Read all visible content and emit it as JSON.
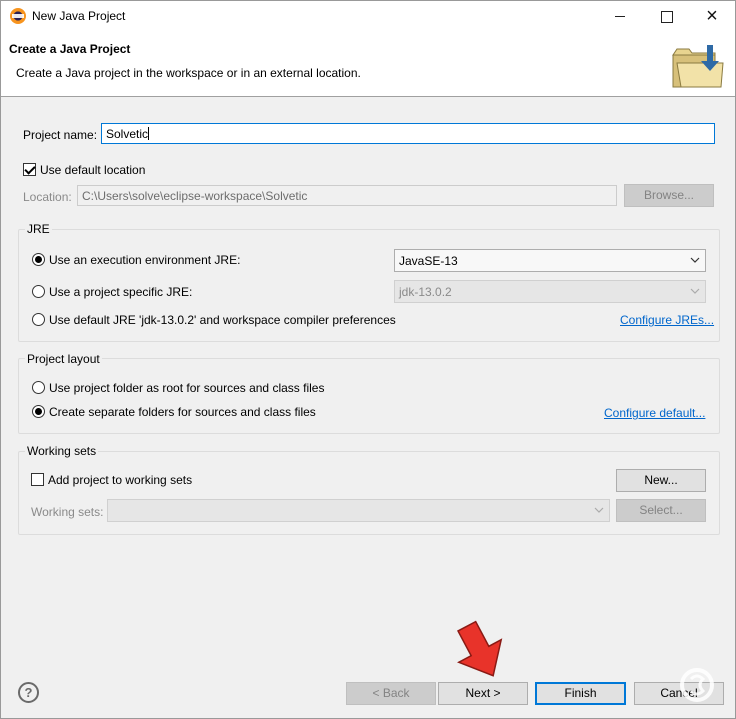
{
  "window": {
    "title": "New Java Project",
    "icon": "eclipse-icon",
    "controls": {
      "minimize": "minimize-icon",
      "maximize": "maximize-icon",
      "close": "×"
    }
  },
  "banner": {
    "title": "Create a Java Project",
    "description": "Create a Java project in the workspace or in an external location."
  },
  "project_name": {
    "label": "Project name:",
    "value": "Solvetic"
  },
  "location": {
    "use_default_label": "Use default location",
    "use_default_checked": true,
    "label": "Location:",
    "value": "C:\\Users\\solve\\eclipse-workspace\\Solvetic",
    "browse_label": "Browse..."
  },
  "jre": {
    "group_title": "JRE",
    "options": [
      {
        "label": "Use an execution environment JRE:",
        "selected": true
      },
      {
        "label": "Use a project specific JRE:",
        "selected": false
      },
      {
        "label": "Use default JRE 'jdk-13.0.2' and workspace compiler preferences",
        "selected": false
      }
    ],
    "execution_env_value": "JavaSE-13",
    "project_jre_value": "jdk-13.0.2",
    "configure_link": "Configure JREs..."
  },
  "layout": {
    "group_title": "Project layout",
    "options": [
      {
        "label": "Use project folder as root for sources and class files",
        "selected": false
      },
      {
        "label": "Create separate folders for sources and class files",
        "selected": true
      }
    ],
    "configure_link": "Configure default..."
  },
  "working_sets": {
    "group_title": "Working sets",
    "add_label": "Add project to working sets",
    "add_checked": false,
    "new_label": "New...",
    "sets_label": "Working sets:",
    "sets_value": "",
    "select_label": "Select..."
  },
  "footer": {
    "help": "?",
    "back_label": "< Back",
    "next_label": "Next >",
    "finish_label": "Finish",
    "cancel_label": "Cancel"
  },
  "colors": {
    "accent": "#0078d7",
    "link": "#0066cc",
    "arrow": "#e8332a"
  }
}
